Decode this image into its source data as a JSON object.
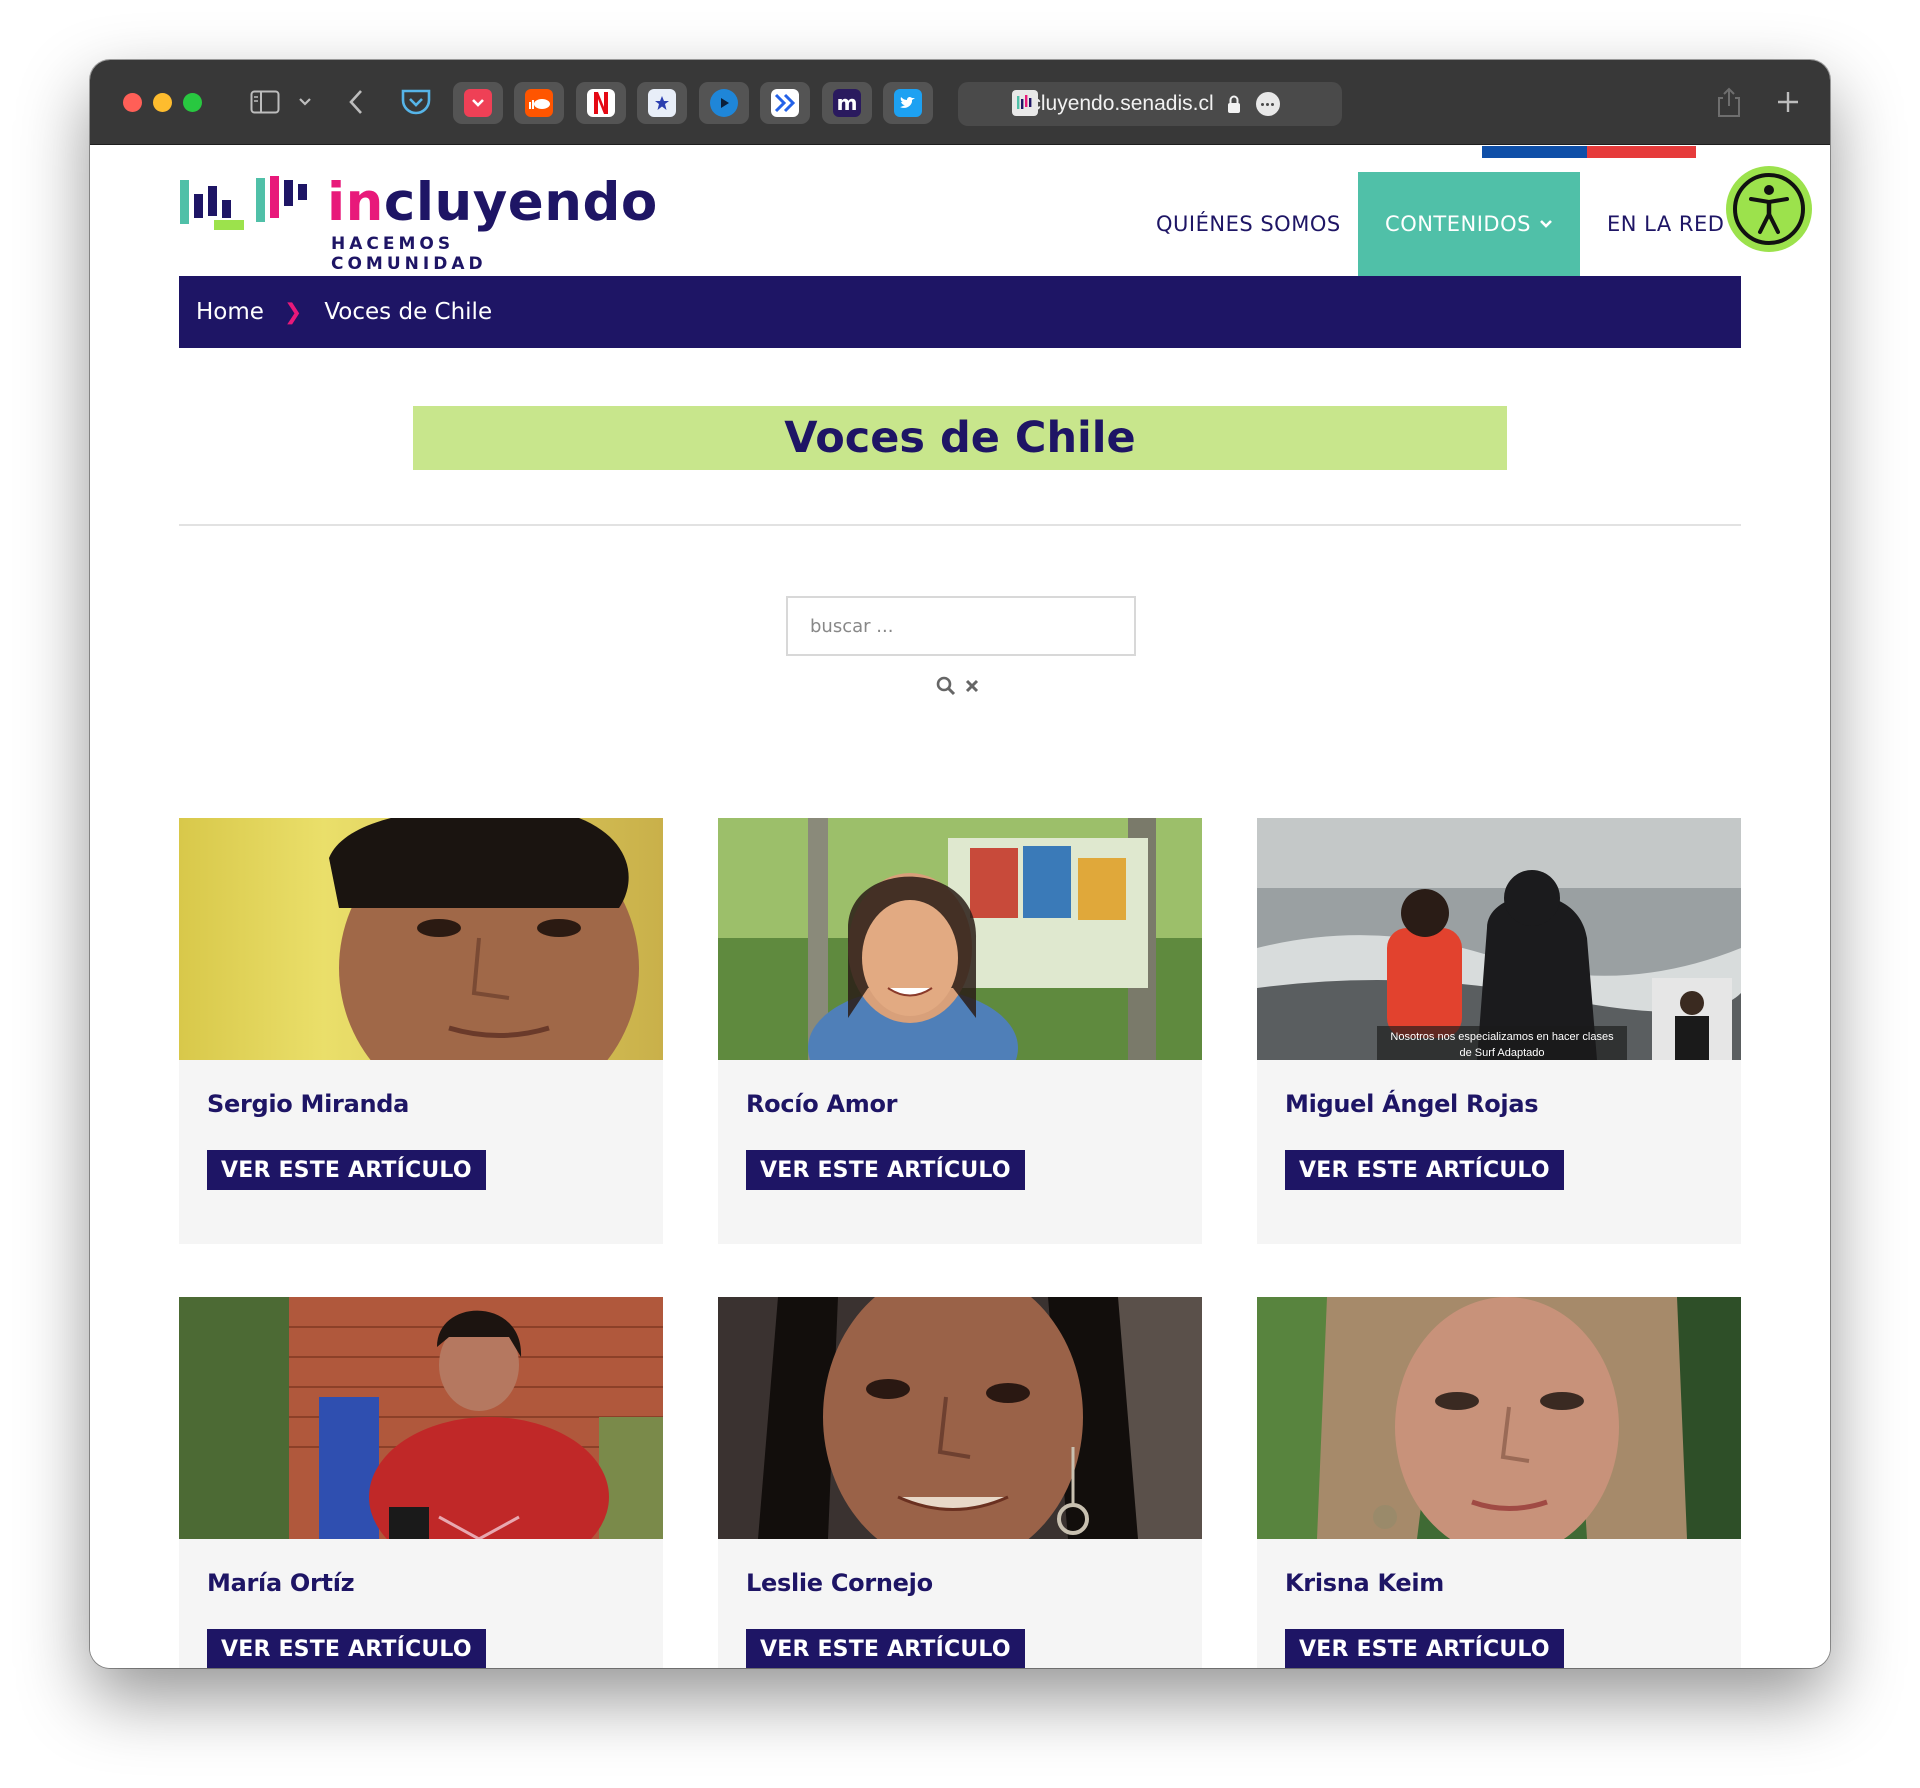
{
  "browser": {
    "url": "incluyendo.senadis.cl",
    "extensions": [
      "pocket-icon",
      "soundcloud-icon",
      "netflix-icon",
      "star-icon",
      "play-icon",
      "forward-icon",
      "m-icon",
      "twitter-icon"
    ]
  },
  "site": {
    "logo_word_start": "in",
    "logo_word_end": "cluyendo",
    "logo_tagline": "HACEMOS COMUNIDAD"
  },
  "nav": {
    "quienes": "QUIÉNES SOMOS",
    "contenidos": "CONTENIDOS",
    "enlared": "EN LA RED"
  },
  "breadcrumb": {
    "home": "Home",
    "current": "Voces de Chile"
  },
  "page": {
    "title": "Voces de Chile"
  },
  "search": {
    "placeholder": "buscar ..."
  },
  "cards": [
    {
      "name": "Sergio Miranda",
      "button": "VER ESTE ARTÍCULO"
    },
    {
      "name": "Rocío Amor",
      "button": "VER ESTE ARTÍCULO"
    },
    {
      "name": "Miguel Ángel Rojas",
      "button": "VER ESTE ARTÍCULO",
      "caption_line1": "Nosotros nos especializamos en hacer clases",
      "caption_line2": "de Surf Adaptado"
    },
    {
      "name": "María Ortíz",
      "button": "VER ESTE ARTÍCULO"
    },
    {
      "name": "Leslie Cornejo",
      "button": "VER ESTE ARTÍCULO"
    },
    {
      "name": "Krisna Keim",
      "button": "VER ESTE ARTÍCULO"
    }
  ],
  "colors": {
    "navy": "#1e1565",
    "teal": "#50c0a8",
    "lime": "#c8e68c",
    "pink": "#e8197a"
  }
}
